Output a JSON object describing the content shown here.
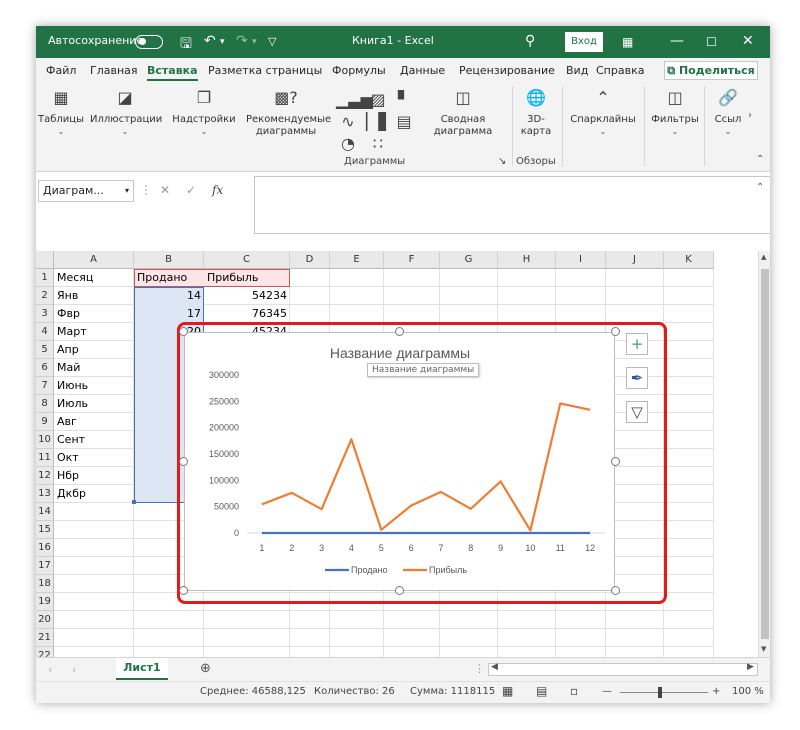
{
  "titlebar": {
    "autosave_label": "Автосохранение",
    "workbook_title": "Книга1 - Excel",
    "login_label": "Вход",
    "save_icon": "save-icon",
    "undo_icon": "undo-icon",
    "redo_icon": "redo-icon",
    "customize_icon": "customize-quick-access-icon",
    "search_icon": "search-icon",
    "ribbon_display_icon": "ribbon-display-icon",
    "minimize_icon": "minimize-icon",
    "maximize_icon": "maximize-icon",
    "close_icon": "close-icon",
    "accent_color": "#217346"
  },
  "tabs": {
    "file": "Файл",
    "home": "Главная",
    "insert": "Вставка",
    "layout": "Разметка страницы",
    "formulas": "Формулы",
    "data": "Данные",
    "review": "Рецензирование",
    "view": "Вид",
    "help": "Справка",
    "share": "Поделиться"
  },
  "ribbon": {
    "tables": "Таблицы",
    "illustrations": "Иллюстрации",
    "addins": "Надстройки",
    "recommended_charts_1": "Рекомендуемые",
    "recommended_charts_2": "диаграммы",
    "pivot_chart_1": "Сводная",
    "pivot_chart_2": "диаграмма",
    "map3d_1": "3D-",
    "map3d_2": "карта",
    "sparklines": "Спарклайны",
    "filters": "Фильтры",
    "links": "Ссыл",
    "group_charts": "Диаграммы",
    "group_tours": "Обзоры"
  },
  "formula_bar": {
    "name_box": "Диаграм...",
    "fx": "fx",
    "cancel_icon": "cancel-icon",
    "enter_icon": "enter-icon",
    "content": ""
  },
  "grid": {
    "columns": [
      "A",
      "B",
      "C",
      "D",
      "E",
      "F",
      "G",
      "H",
      "I",
      "J",
      "K"
    ],
    "rows": [
      "1",
      "2",
      "3",
      "4",
      "5",
      "6",
      "7",
      "8",
      "9",
      "10",
      "11",
      "12",
      "13",
      "14",
      "15",
      "16",
      "17",
      "18",
      "19",
      "20",
      "21",
      "22"
    ],
    "header_a": "Месяц",
    "header_b": "Продано",
    "header_c": "Прибыль",
    "months": [
      "Янв",
      "Фвр",
      "Март",
      "Апр",
      "Май",
      "Июнь",
      "Июль",
      "Авг",
      "Сент",
      "Окт",
      "Нбр",
      "Дкбр"
    ],
    "sold_visible": [
      "14",
      "17",
      "20"
    ],
    "profit_visible": [
      "54234",
      "76345",
      "45234"
    ]
  },
  "chart": {
    "title_text": "Название диаграммы",
    "tooltip": "Название диаграммы",
    "add_element_icon": "plus-icon",
    "styles_icon": "brush-icon",
    "filter_icon": "funnel-icon"
  },
  "chart_data": {
    "type": "line",
    "title": "Название диаграммы",
    "x": [
      1,
      2,
      3,
      4,
      5,
      6,
      7,
      8,
      9,
      10,
      11,
      12
    ],
    "ylim": [
      0,
      300000
    ],
    "yticks": [
      0,
      50000,
      100000,
      150000,
      200000,
      250000,
      300000
    ],
    "series": [
      {
        "name": "Продано",
        "color": "#4472c4",
        "values": [
          14,
          17,
          20,
          18,
          15,
          22,
          25,
          19,
          21,
          16,
          24,
          23
        ]
      },
      {
        "name": "Прибыль",
        "color": "#ed7d31",
        "values": [
          54234,
          76345,
          45234,
          178000,
          6000,
          52000,
          78000,
          46000,
          98000,
          5000,
          246000,
          234000
        ]
      }
    ],
    "legend": "bottom",
    "grid": false
  },
  "sheets": {
    "active": "Лист1",
    "add_icon": "add-sheet-icon"
  },
  "status": {
    "average": "Среднее: 46588,125",
    "count": "Количество: 26",
    "sum": "Сумма: 1118115",
    "zoom": "100 %"
  }
}
